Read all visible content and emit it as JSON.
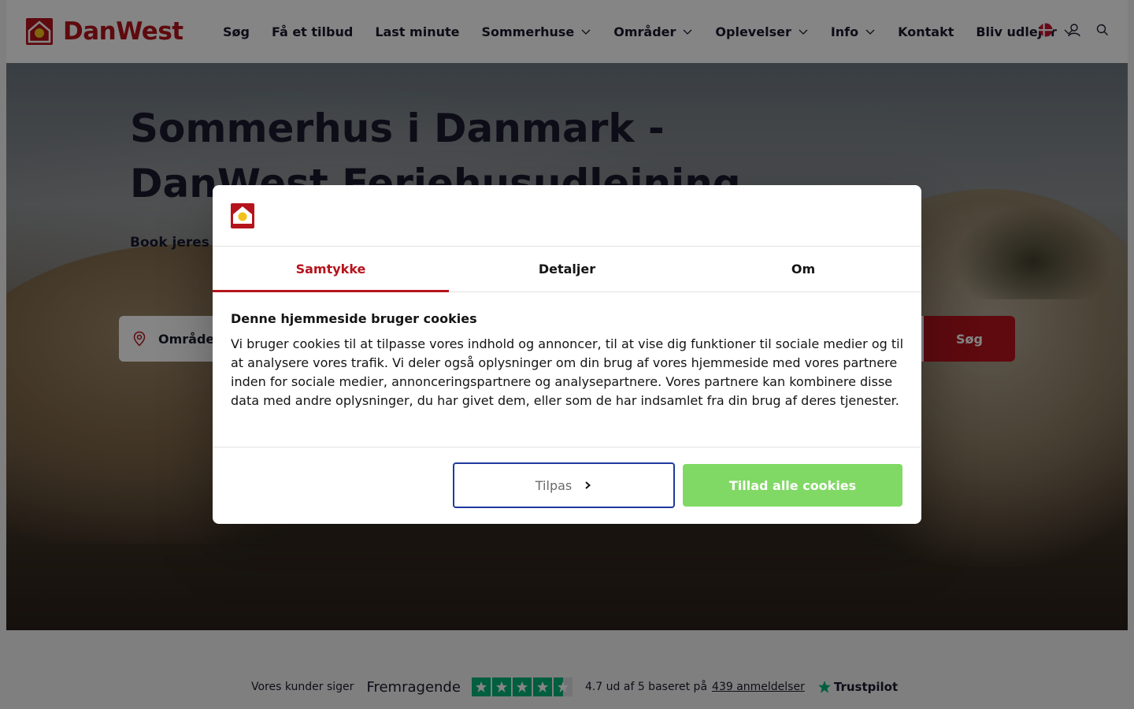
{
  "header": {
    "brand": "DanWest",
    "nav": [
      {
        "label": "Søg",
        "has_dropdown": false
      },
      {
        "label": "Få et tilbud",
        "has_dropdown": false
      },
      {
        "label": "Last minute",
        "has_dropdown": false
      },
      {
        "label": "Sommerhuse",
        "has_dropdown": true
      },
      {
        "label": "Områder",
        "has_dropdown": true
      },
      {
        "label": "Oplevelser",
        "has_dropdown": true
      },
      {
        "label": "Info",
        "has_dropdown": true
      },
      {
        "label": "Kontakt",
        "has_dropdown": false
      },
      {
        "label": "Bliv udlejer",
        "has_dropdown": true
      }
    ],
    "tools": [
      "danish-flag-icon",
      "user-icon",
      "search-icon"
    ]
  },
  "hero": {
    "title": "Sommerhus i Danmark - DanWest Feriehusudlejning",
    "subtitle": "Book jeres n",
    "search": {
      "area_label": "Område",
      "button_label": "Søg"
    }
  },
  "trustpilot": {
    "lead": "Vores kunder siger",
    "rating_word": "Fremragende",
    "stars": 4.5,
    "score_text": "4.7 ud af 5 baseret på",
    "reviews_link": "439 anmeldelser",
    "brand": "Trustpilot"
  },
  "cookie_dialog": {
    "tabs": [
      "Samtykke",
      "Detaljer",
      "Om"
    ],
    "active_tab": "Samtykke",
    "heading": "Denne hjemmeside bruger cookies",
    "body": "Vi bruger cookies til at tilpasse vores indhold og annoncer, til at vise dig funktioner til sociale medier og til at analysere vores trafik. Vi deler også oplysninger om din brug af vores hjemmeside med vores partnere inden for sociale medier, annonceringspartnere og analysepartnere. Vores partnere kan kombinere disse data med andre oplysninger, du har givet dem, eller som de har indsamlet fra din brug af deres tjenester.",
    "customize_label": "Tilpas",
    "allow_all_label": "Tillad alle cookies"
  },
  "colors": {
    "brand_red": "#b5141c",
    "accept_green": "#80d964",
    "focus_blue": "#1f3aa0",
    "trustpilot_green": "#00b67a",
    "text_dark": "#1a1a2e"
  }
}
